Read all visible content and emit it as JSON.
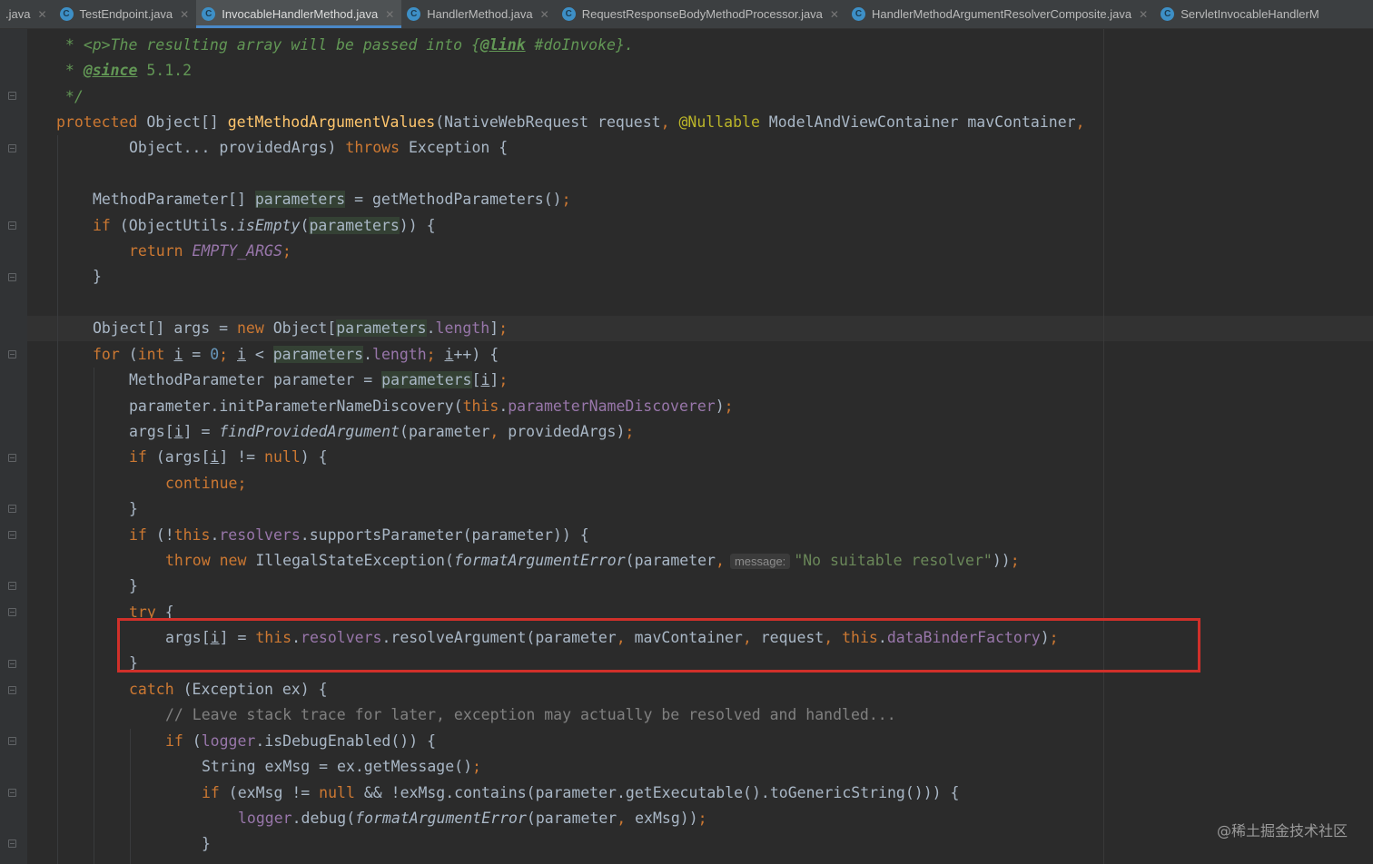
{
  "tabs": [
    {
      "label": ".java",
      "icon": "none",
      "active": false
    },
    {
      "label": "TestEndpoint.java",
      "icon": "class-icon",
      "active": false
    },
    {
      "label": "InvocableHandlerMethod.java",
      "icon": "class-icon",
      "active": true
    },
    {
      "label": "HandlerMethod.java",
      "icon": "class-icon",
      "active": false
    },
    {
      "label": "RequestResponseBodyMethodProcessor.java",
      "icon": "class-icon",
      "active": false
    },
    {
      "label": "HandlerMethodArgumentResolverComposite.java",
      "icon": "class-icon",
      "active": false
    },
    {
      "label": "ServletInvocableHandlerM",
      "icon": "class-icon",
      "active": false
    }
  ],
  "code": {
    "l1": {
      "star": " * ",
      "p_tag": "<p>",
      "text": "The resulting array will be passed into ",
      "link_open": "{",
      "link_tag": "@link",
      "link_ref": " #doInvoke",
      "link_close": "}."
    },
    "l2": {
      "star": " * ",
      "since_tag": "@since",
      "version": " 5.1.2"
    },
    "l3": {
      "text": " */"
    },
    "l4": {
      "mod": "protected",
      "type": " Object[] ",
      "name": "getMethodArgumentValues",
      "p1": "(NativeWebRequest request",
      "comma1": ", ",
      "ann": "@Nullable",
      "p2": " ModelAndViewContainer mavContainer",
      "comma2": ","
    },
    "l5": {
      "p3": "Object... providedArgs) ",
      "throws": "throws",
      "rest": " Exception {"
    },
    "l7": {
      "type": "MethodParameter[] ",
      "var": "parameters",
      "eq": " = getMethodParameters()",
      "semi": ";"
    },
    "l8": {
      "kw": "if",
      "a": " (ObjectUtils.",
      "call": "isEmpty",
      "b": "(",
      "var": "parameters",
      "c": ")) {"
    },
    "l9": {
      "kw": "return",
      "sp": " ",
      "const": "EMPTY_ARGS",
      "semi": ";"
    },
    "l10": {
      "text": "}"
    },
    "l12": {
      "a": "Object[] args = ",
      "new": "new",
      "b": " Object[",
      "var": "parameters",
      "dot": ".",
      "len": "length",
      "c": "]",
      "semi": ";"
    },
    "l13": {
      "for": "for",
      "a": " (",
      "int": "int",
      "sp": " ",
      "i1": "i",
      "b": " = ",
      "zero": "0",
      "s1": "; ",
      "i2": "i",
      "c": " < ",
      "var": "parameters",
      "dot": ".",
      "len": "length",
      "s2": "; ",
      "i3": "i",
      "d": "++) {"
    },
    "l14": {
      "a": "MethodParameter parameter = ",
      "var": "parameters",
      "b": "[",
      "i": "i",
      "c": "]",
      "semi": ";"
    },
    "l15": {
      "a": "parameter.initParameterNameDiscovery(",
      "this": "this",
      "dot": ".",
      "fld": "parameterNameDiscoverer",
      "b": ")",
      "semi": ";"
    },
    "l16": {
      "a": "args[",
      "i": "i",
      "b": "] = ",
      "call": "findProvidedArgument",
      "c": "(parameter",
      "comma": ", ",
      "d": "providedArgs)",
      "semi": ";"
    },
    "l17": {
      "kw": "if",
      "a": " (args[",
      "i": "i",
      "b": "] != ",
      "null": "null",
      "c": ") {"
    },
    "l18": {
      "kw": "continue",
      "semi": ";"
    },
    "l19": {
      "text": "}"
    },
    "l20": {
      "kw": "if",
      "a": " (!",
      "this": "this",
      "dot": ".",
      "fld": "resolvers",
      "b": ".supportsParameter(parameter)) {"
    },
    "l21": {
      "throw": "throw",
      "sp": " ",
      "new": "new",
      "a": " IllegalStateException(",
      "call": "formatArgumentError",
      "b": "(parameter",
      "comma": ",",
      "hint": "message:",
      "str": "\"No suitable resolver\"",
      "c": "))",
      "semi": ";"
    },
    "l22": {
      "text": "}"
    },
    "l23": {
      "kw": "try",
      "b": " {"
    },
    "l24": {
      "a": "args[",
      "i": "i",
      "b": "] = ",
      "this1": "this",
      "dot1": ".",
      "fld1": "resolvers",
      "c": ".resolveArgument(parameter",
      "cm1": ", ",
      "d": "mavContainer",
      "cm2": ", ",
      "e": "request",
      "cm3": ", ",
      "this2": "this",
      "dot2": ".",
      "fld2": "dataBinderFactory",
      "f": ")",
      "semi": ";"
    },
    "l25": {
      "text": "}"
    },
    "l26": {
      "kw": "catch",
      "a": " (Exception ex) {"
    },
    "l27": {
      "text": "// Leave stack trace for later, exception may actually be resolved and handled..."
    },
    "l28": {
      "kw": "if",
      "a": " (",
      "fld": "logger",
      "b": ".isDebugEnabled()) {"
    },
    "l29": {
      "a": "String exMsg = ex.getMessage()",
      "semi": ";"
    },
    "l30": {
      "kw": "if",
      "a": " (exMsg != ",
      "null": "null",
      "b": " && !exMsg.contains(parameter.getExecutable().toGenericString())) {"
    },
    "l31": {
      "fld": "logger",
      "a": ".debug(",
      "call": "formatArgumentError",
      "b": "(parameter",
      "comma": ", ",
      "c": "exMsg))",
      "semi": ";"
    },
    "l32": {
      "text": "}"
    }
  },
  "watermark": "@稀土掘金技术社区",
  "colors": {
    "highlight_box": "#d0302a",
    "background": "#2b2b2b",
    "keyword": "#cc7832"
  }
}
